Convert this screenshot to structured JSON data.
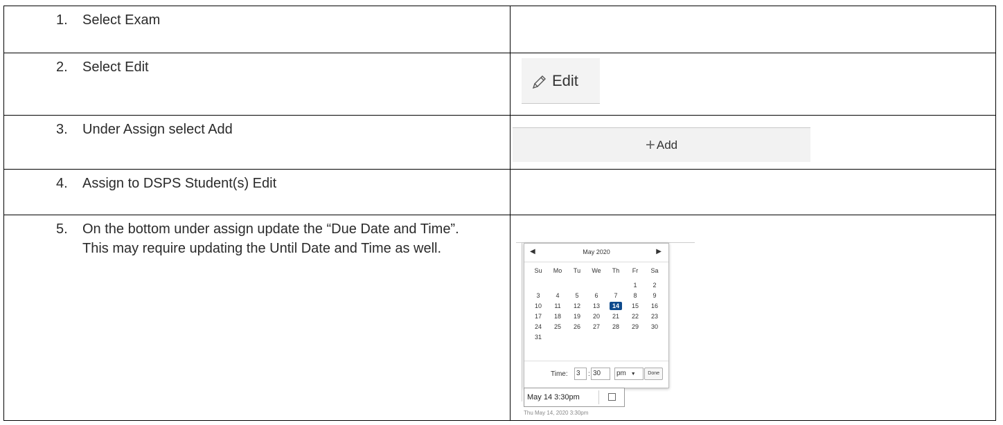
{
  "steps": [
    {
      "num": "1.",
      "text": "Select Exam"
    },
    {
      "num": "2.",
      "text": "Select Edit"
    },
    {
      "num": "3.",
      "text": "Under Assign select Add"
    },
    {
      "num": "4.",
      "text": "Assign to DSPS Student(s) Edit"
    },
    {
      "num": "5.",
      "text": "On the bottom under assign update the “Due Date and Time”.  This may require updating the Until Date and Time as well."
    }
  ],
  "edit_button": {
    "label": "Edit",
    "icon": "pencil-icon"
  },
  "add_button": {
    "label": "Add",
    "icon": "plus-icon"
  },
  "calendar": {
    "month": "May 2020",
    "prev_icon": "◀",
    "next_icon": "▶",
    "weekdays": [
      "Su",
      "Mo",
      "Tu",
      "We",
      "Th",
      "Fr",
      "Sa"
    ],
    "weeks": [
      [
        "",
        "",
        "",
        "",
        "",
        "1",
        "2"
      ],
      [
        "3",
        "4",
        "5",
        "6",
        "7",
        "8",
        "9"
      ],
      [
        "10",
        "11",
        "12",
        "13",
        "14",
        "15",
        "16"
      ],
      [
        "17",
        "18",
        "19",
        "20",
        "21",
        "22",
        "23"
      ],
      [
        "24",
        "25",
        "26",
        "27",
        "28",
        "29",
        "30"
      ],
      [
        "31",
        "",
        "",
        "",
        "",
        "",
        ""
      ]
    ],
    "selected_day": "14",
    "time_label": "Time:",
    "hour": "3",
    "minute": "30",
    "ampm": "pm",
    "ampm_arrow": "▼",
    "done_label": "Done",
    "selected_color": "#0e4a8c"
  },
  "date_input": {
    "value": "May 14 3:30pm",
    "hint": "Thu May 14, 2020 3:30pm"
  }
}
